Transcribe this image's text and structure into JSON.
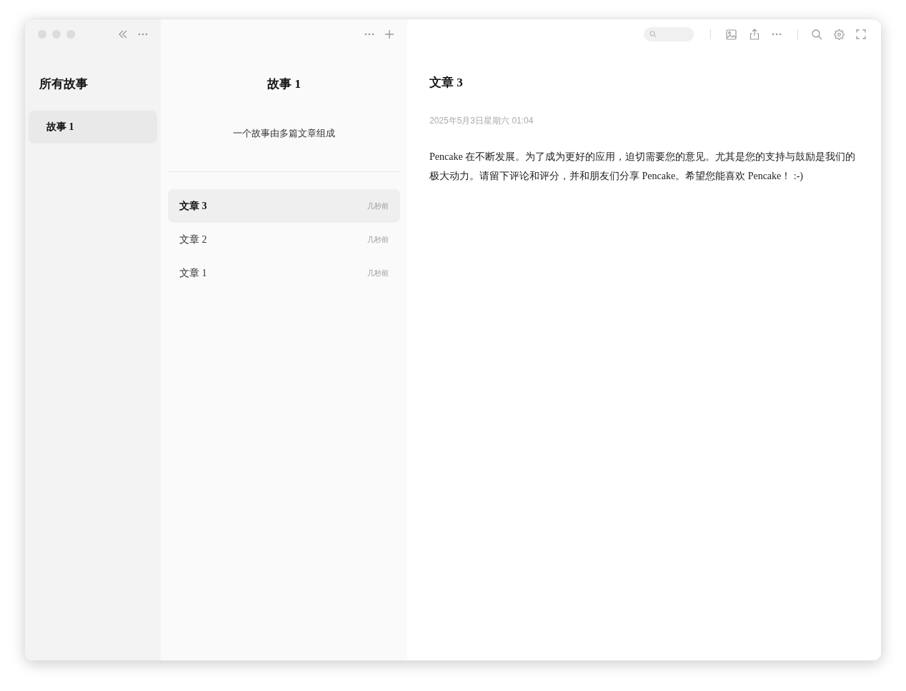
{
  "sidebar": {
    "title": "所有故事",
    "stories": [
      {
        "label": "故事 1",
        "selected": true
      }
    ]
  },
  "story": {
    "title": "故事 1",
    "description": "一个故事由多篇文章组成",
    "articles": [
      {
        "title": "文章 3",
        "time": "几秒前",
        "selected": true
      },
      {
        "title": "文章 2",
        "time": "几秒前",
        "selected": false
      },
      {
        "title": "文章 1",
        "time": "几秒前",
        "selected": false
      }
    ]
  },
  "article": {
    "title": "文章 3",
    "date": "2025年5月3日星期六 01:04",
    "body": "Pencake 在不断发展。为了成为更好的应用，迫切需要您的意见。尤其是您的支持与鼓励是我们的极大动力。请留下评论和评分，并和朋友们分享 Pencake。希望您能喜欢 Pencake！ :-)"
  }
}
